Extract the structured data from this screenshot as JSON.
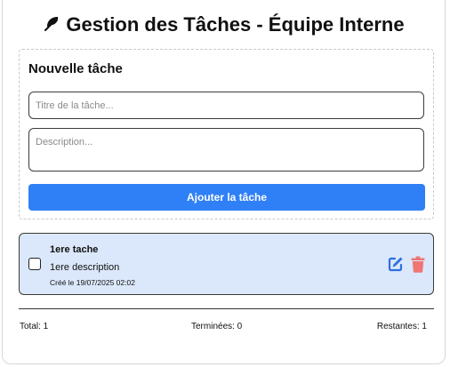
{
  "header": {
    "title": "Gestion des Tâches - Équipe Interne",
    "icon": "feather-leaf-icon"
  },
  "form": {
    "heading": "Nouvelle tâche",
    "title_placeholder": "Titre de la tâche...",
    "title_value": "",
    "description_placeholder": "Description...",
    "description_value": "",
    "add_label": "Ajouter la tâche",
    "accent_color": "#2f80f7"
  },
  "tasks": [
    {
      "title": "1ere tache",
      "description": "1ere description",
      "created": "Créé le 19/07/2025 02:02",
      "completed": false,
      "edit_icon": "pen-to-square-icon",
      "edit_color": "#2f6fe0",
      "delete_icon": "trash-icon",
      "delete_color": "#f07575",
      "card_color": "#dbe8fb"
    }
  ],
  "stats": {
    "total": "Total: 1",
    "done": "Terminées: 0",
    "remaining": "Restantes: 1"
  }
}
